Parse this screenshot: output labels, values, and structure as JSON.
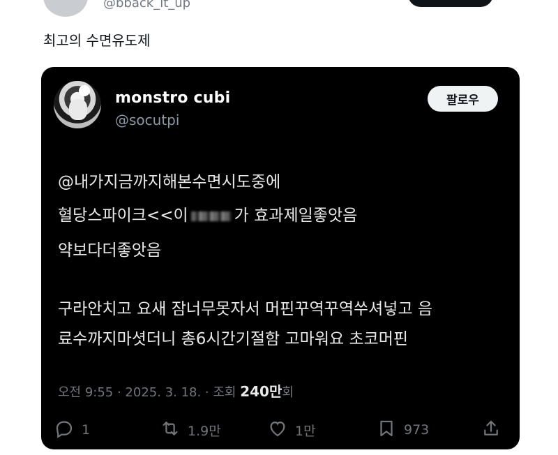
{
  "outer": {
    "handle": "@bback_it_up",
    "text": "최고의 수면유도제"
  },
  "quoted": {
    "display_name": "monstro cubi",
    "handle": "@socutpi",
    "follow_label": "팔로우",
    "lines": [
      "@내가지금까지해본수면시도중에",
      "혈당스파이크<<이",
      "가 효과제일좋앗음",
      "약보다더좋앗음",
      "구라안치고 요새 잠너무못자서  머핀꾸역꾸역쑤셔넣고 음",
      "료수까지마셧더니  총6시간기절함 고마워요  초코머핀"
    ],
    "meta": {
      "time": "오전 9:55 · 2025. 3. 18. · 조회 ",
      "views": "240만",
      "views_suffix": "회"
    },
    "actions": {
      "reply": "1",
      "retweet": "1.9만",
      "like": "1만",
      "bookmark": "973"
    },
    "colors": {
      "card_bg": "#000000",
      "text": "#e7e9ea",
      "muted": "#71767b"
    }
  }
}
